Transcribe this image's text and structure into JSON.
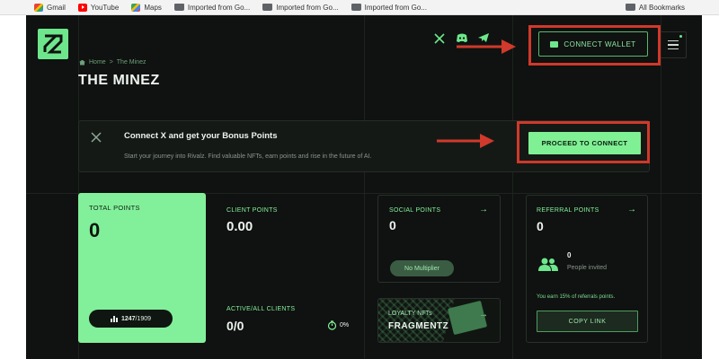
{
  "bookmarks_bar": {
    "items": [
      {
        "label": "Gmail",
        "icon": "gmail-icon"
      },
      {
        "label": "YouTube",
        "icon": "youtube-icon"
      },
      {
        "label": "Maps",
        "icon": "maps-icon"
      },
      {
        "label": "Imported from Go...",
        "icon": "folder-icon"
      },
      {
        "label": "Imported from Go...",
        "icon": "folder-icon"
      },
      {
        "label": "Imported from Go...",
        "icon": "folder-icon"
      }
    ],
    "all_bookmarks": "All Bookmarks"
  },
  "header": {
    "connect_wallet_label": "CONNECT WALLET",
    "social_icons": [
      "x-icon",
      "discord-icon",
      "telegram-icon"
    ]
  },
  "breadcrumb": {
    "home": "Home",
    "separator": ">",
    "current": "The Minez"
  },
  "page_title": "THE MINEZ",
  "banner": {
    "title": "Connect X and get your Bonus Points",
    "subtitle": "Start your journey into Rivalz. Find valuable NFTs, earn points and rise in the future of AI.",
    "button_label": "PROCEED TO CONNECT"
  },
  "total_points": {
    "label": "TOTAL POINTS",
    "value": "0",
    "rank": "1247",
    "rank_total": "/1909"
  },
  "client_points": {
    "label": "CLIENT POINTS",
    "value": "0.00"
  },
  "active_clients": {
    "label": "ACTIVE/ALL CLIENTS",
    "value": "0/0",
    "percent": "0%"
  },
  "social_points": {
    "label": "SOCIAL POINTS",
    "value": "0",
    "multiplier": "No Multiplier"
  },
  "loyalty": {
    "label": "LOYALTY NFTs",
    "value": "FRAGMENTZ"
  },
  "referral": {
    "label": "REFERRAL POINTS",
    "value": "0",
    "invited_count": "0",
    "invited_label": "People invited",
    "earn_note": "You earn 15% of referrals points.",
    "copy_label": "COPY LINK"
  },
  "colors": {
    "accent": "#82f09a",
    "background": "#0f1210",
    "annotation": "#d0392b"
  }
}
